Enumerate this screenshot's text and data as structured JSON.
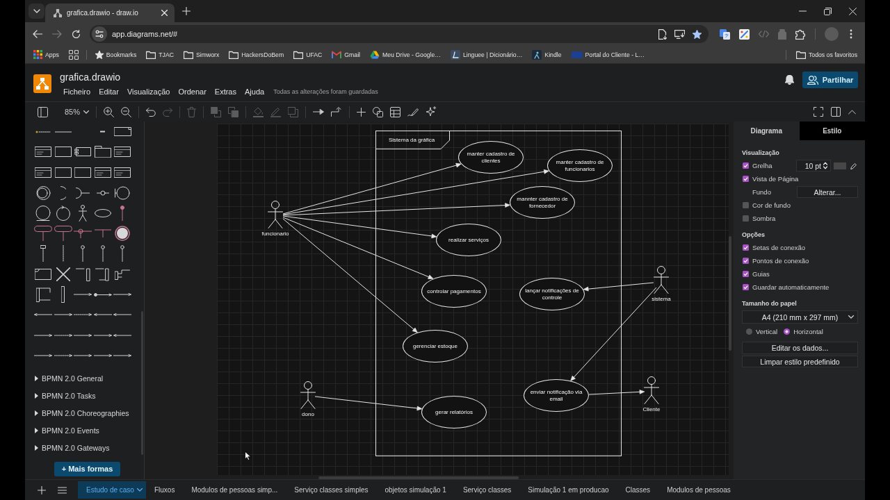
{
  "browser": {
    "tab_title": "grafica.drawio - draw.io",
    "nav": [
      {
        "kind": "back",
        "disabled": false
      },
      {
        "kind": "forward",
        "disabled": true
      },
      {
        "kind": "reload",
        "disabled": false
      }
    ],
    "address": "app.diagrams.net/#",
    "bookmarked": true,
    "extensions": [
      {
        "kind": "translate",
        "disabled": false
      },
      {
        "kind": "palette",
        "disabled": false
      },
      {
        "kind": "code",
        "disabled": true
      },
      {
        "kind": "jar",
        "disabled": true
      },
      {
        "kind": "puzzle",
        "disabled": false
      }
    ],
    "bookmarks": [
      {
        "kind": "apps",
        "label": "Apps"
      },
      {
        "kind": "grid"
      },
      {
        "kind": "star",
        "label": "Bookmarks"
      },
      {
        "kind": "folder",
        "label": "TJAC"
      },
      {
        "kind": "folder",
        "label": "Simworx"
      },
      {
        "kind": "folder",
        "label": "HackersDoBem"
      },
      {
        "kind": "folder",
        "label": "UFAC"
      },
      {
        "kind": "gmail",
        "label": "Gmail"
      },
      {
        "kind": "drive",
        "label": "Meu Drive - Google…"
      },
      {
        "kind": "linguee",
        "label": "Linguee | Dicionário…"
      },
      {
        "kind": "kindle",
        "label": "Kindle"
      },
      {
        "kind": "portal",
        "label": "Portal do Cliente - L…"
      }
    ],
    "all_bookmarks": "Todos os favoritos"
  },
  "app": {
    "file_name": "grafica.drawio",
    "menu": [
      "Ficheiro",
      "Editar",
      "Visualização",
      "Ordenar",
      "Extras",
      "Ajuda"
    ],
    "save_status": "Todas as alterações foram guardadas",
    "share_button": "Partilhar"
  },
  "toolbar": {
    "groups": [
      [
        {
          "kind": "panel",
          "disabled": false
        },
        {
          "kind": "zoom",
          "label": "85%",
          "disabled": false
        }
      ],
      [
        {
          "kind": "zoomin",
          "disabled": false
        },
        {
          "kind": "zoomout",
          "disabled": false
        }
      ],
      [
        {
          "kind": "undo",
          "disabled": false
        },
        {
          "kind": "redo",
          "disabled": true
        }
      ],
      [
        {
          "kind": "delete",
          "disabled": true
        }
      ],
      [
        {
          "kind": "tofront",
          "disabled": true
        },
        {
          "kind": "toback",
          "disabled": true
        }
      ],
      [
        {
          "kind": "fill",
          "disabled": true
        },
        {
          "kind": "line",
          "disabled": true
        },
        {
          "kind": "shadow",
          "disabled": true
        }
      ],
      [
        {
          "kind": "connection",
          "disabled": false
        },
        {
          "kind": "waypoint",
          "disabled": false
        }
      ],
      [
        {
          "kind": "insert",
          "disabled": false
        },
        {
          "kind": "shapes",
          "disabled": false
        },
        {
          "kind": "table",
          "disabled": false
        },
        {
          "kind": "freehand",
          "disabled": false
        },
        {
          "kind": "ai",
          "disabled": false
        }
      ]
    ],
    "right": [
      {
        "kind": "fullscreen",
        "disabled": false
      },
      {
        "kind": "formatpanel",
        "disabled": false
      },
      {
        "kind": "collapse",
        "disabled": false
      }
    ]
  },
  "shapes_panel": {
    "sections": [
      {
        "label": "BPMN 2.0 General",
        "expanded": false
      },
      {
        "label": "BPMN 2.0 Tasks",
        "expanded": false
      },
      {
        "label": "BPMN 2.0 Choreographies",
        "expanded": false
      },
      {
        "label": "BPMN 2.0 Events",
        "expanded": false
      },
      {
        "label": "BPMN 2.0 Gateways",
        "expanded": false
      }
    ],
    "more_shapes_button": "+ Mais formas"
  },
  "canvas": {
    "boundary_title": "Sistema da gráfica",
    "use_cases": [
      {
        "label": "manter cadastro de clientes"
      },
      {
        "label": "manter cadastro de funcionarios"
      },
      {
        "label": "mannter cadastro de fornecedor"
      },
      {
        "label": "realizar serviços"
      },
      {
        "label": "controlar pagamentos"
      },
      {
        "label": "lançar notificações de controle"
      },
      {
        "label": "gerenciar estoque"
      },
      {
        "label": "enviar notificação via email"
      },
      {
        "label": "gerar relatórios"
      }
    ],
    "actors": [
      {
        "label": "funcionario"
      },
      {
        "label": "sistema"
      },
      {
        "label": "dono"
      },
      {
        "label": "Cliente"
      }
    ]
  },
  "format_panel": {
    "tabs": [
      {
        "label": "Diagrama",
        "selected": true
      },
      {
        "label": "Estilo",
        "selected": false
      }
    ],
    "sections": [
      {
        "title": "Visualização",
        "rows": [
          {
            "kind": "checkbox",
            "label": "Grelha",
            "checked": true,
            "size_field": "10 pt"
          },
          {
            "kind": "checkbox",
            "label": "Vista de Página",
            "checked": true
          },
          {
            "kind": "button",
            "label": "Fundo",
            "button": "Alterar..."
          },
          {
            "kind": "checkbox",
            "label": "Cor de fundo",
            "checked": false
          },
          {
            "kind": "checkbox",
            "label": "Sombra",
            "checked": false
          }
        ]
      },
      {
        "title": "Opções",
        "rows": [
          {
            "kind": "checkbox",
            "label": "Setas de conexão",
            "checked": true
          },
          {
            "kind": "checkbox",
            "label": "Pontos de conexão",
            "checked": true
          },
          {
            "kind": "checkbox",
            "label": "Guias",
            "checked": true
          },
          {
            "kind": "checkbox",
            "label": "Guardar automaticamente",
            "checked": true
          }
        ]
      },
      {
        "title": "Tamanho do papel",
        "rows": [
          {
            "kind": "select",
            "value": "A4 (210 mm x 297 mm)"
          },
          {
            "kind": "radios",
            "options": [
              {
                "label": "Vertical",
                "selected": false
              },
              {
                "label": "Horizontal",
                "selected": true
              }
            ]
          }
        ]
      }
    ],
    "buttons": [
      "Editar os dados...",
      "Limpar estilo predefinido"
    ]
  },
  "pages": {
    "tabs": [
      {
        "label": "Estudo de caso",
        "selected": true
      },
      {
        "label": "Fluxos",
        "selected": false
      },
      {
        "label": "Modulos de pessoas simp...",
        "selected": false
      },
      {
        "label": "Serviço classes simples",
        "selected": false
      },
      {
        "label": "objetos simulação 1",
        "selected": false
      },
      {
        "label": "Serviço classes",
        "selected": false
      },
      {
        "label": "Simulação 1 em producao",
        "selected": false
      },
      {
        "label": "Classes",
        "selected": false
      },
      {
        "label": "Modulos de pessoas",
        "selected": false
      }
    ]
  }
}
